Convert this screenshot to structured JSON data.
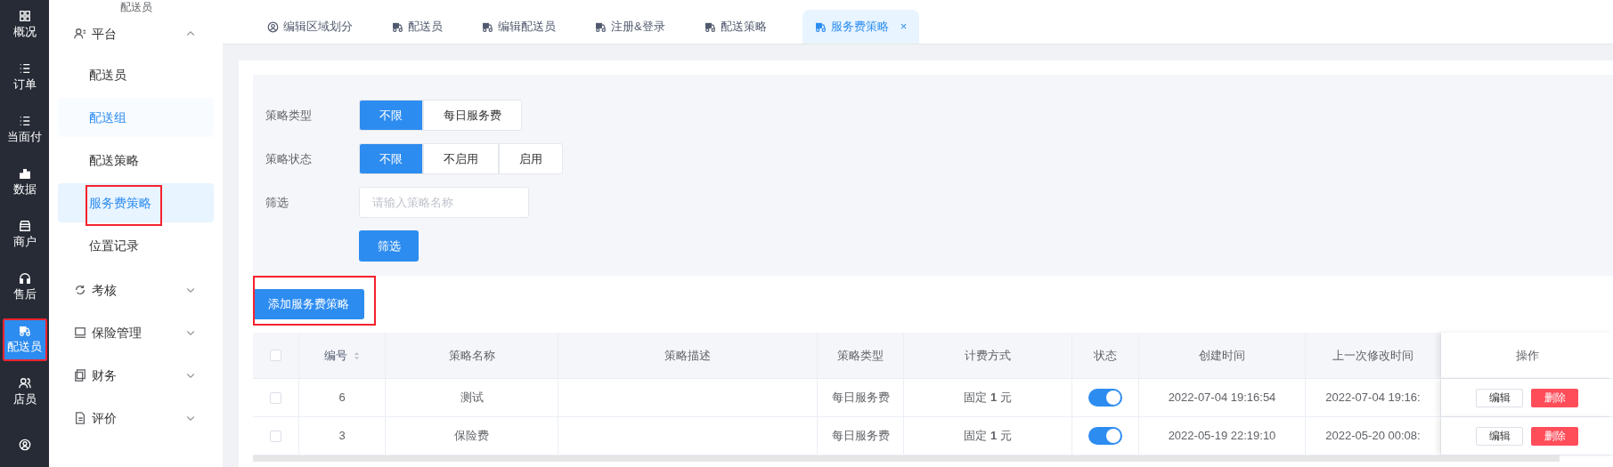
{
  "rail": [
    {
      "label": "概况",
      "selected": false,
      "highlighted": false
    },
    {
      "label": "订单",
      "selected": false,
      "highlighted": false
    },
    {
      "label": "当面付",
      "selected": false,
      "highlighted": false
    },
    {
      "label": "数据",
      "selected": false,
      "highlighted": false
    },
    {
      "label": "商户",
      "selected": false,
      "highlighted": false
    },
    {
      "label": "售后",
      "selected": false,
      "highlighted": false
    },
    {
      "label": "配送员",
      "selected": true,
      "highlighted": true
    },
    {
      "label": "店员",
      "selected": false,
      "highlighted": false
    },
    {
      "selected": false,
      "highlighted": false
    }
  ],
  "sidebar": {
    "header": "配送员",
    "groups": [
      {
        "label": "平台",
        "expanded": true,
        "children": [
          {
            "label": "配送员",
            "selected": false,
            "hovered": false,
            "highlighted": false
          },
          {
            "label": "配送组",
            "selected": false,
            "hovered": true,
            "highlighted": false
          },
          {
            "label": "配送策略",
            "selected": false,
            "hovered": false,
            "highlighted": false
          },
          {
            "label": "服务费策略",
            "selected": true,
            "hovered": false,
            "highlighted": true
          },
          {
            "label": "位置记录",
            "selected": false,
            "hovered": false,
            "highlighted": false
          }
        ]
      },
      {
        "label": "考核",
        "expanded": false
      },
      {
        "label": "保险管理",
        "expanded": false
      },
      {
        "label": "财务",
        "expanded": false
      },
      {
        "label": "评价",
        "expanded": false
      }
    ]
  },
  "tabs": [
    {
      "label": "编辑区域划分",
      "selected": false,
      "closable": false
    },
    {
      "label": "配送员",
      "selected": false,
      "closable": false
    },
    {
      "label": "编辑配送员",
      "selected": false,
      "closable": false
    },
    {
      "label": "注册&登录",
      "selected": false,
      "closable": false
    },
    {
      "label": "配送策略",
      "selected": false,
      "closable": false
    },
    {
      "label": "服务费策略",
      "selected": true,
      "closable": true,
      "close": "×"
    }
  ],
  "filters": {
    "rows": [
      {
        "kind": "segmented",
        "label": "策略类型",
        "options": [
          {
            "label": "不限",
            "selected": true
          },
          {
            "label": "每日服务费",
            "selected": false
          }
        ]
      },
      {
        "kind": "segmented",
        "label": "策略状态",
        "options": [
          {
            "label": "不限",
            "selected": true
          },
          {
            "label": "不启用",
            "selected": false
          },
          {
            "label": "启用",
            "selected": false
          }
        ]
      },
      {
        "kind": "text",
        "label": "筛选",
        "placeholder": "请输入策略名称"
      }
    ],
    "submit": "筛选"
  },
  "add_button": {
    "label": "添加服务费策略",
    "highlighted": true
  },
  "table": {
    "header_checked": false,
    "columns": [
      {
        "label": "编号",
        "sortable": true
      },
      {
        "label": "策略名称",
        "sortable": false
      },
      {
        "label": "策略描述",
        "sortable": false
      },
      {
        "label": "策略类型",
        "sortable": false
      },
      {
        "label": "计费方式",
        "sortable": false
      },
      {
        "label": "状态",
        "sortable": false
      },
      {
        "label": "创建时间",
        "sortable": false
      },
      {
        "label": "上一次修改时间",
        "sortable": false
      },
      {
        "label": "操作",
        "sortable": false
      }
    ],
    "rows": [
      {
        "checked": false,
        "id": "6",
        "name": "测试",
        "type": "每日服务费",
        "billing": "固定 **1** 元",
        "enabled": true,
        "created": "2022-07-04 19:16:54",
        "modified": "2022-07-04 19:16:",
        "actions": [
          "编辑",
          "删除"
        ]
      },
      {
        "checked": false,
        "id": "3",
        "name": "保险费",
        "type": "每日服务费",
        "billing": "固定 **1** 元",
        "enabled": true,
        "created": "2022-05-19 22:19:10",
        "modified": "2022-05-20 00:08:",
        "actions": [
          "编辑",
          "删除"
        ]
      }
    ]
  }
}
